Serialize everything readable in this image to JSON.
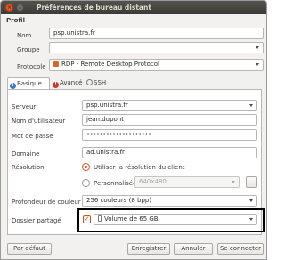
{
  "window": {
    "title": "Préférences de bureau distant"
  },
  "profile": {
    "section_label": "Profil",
    "name_label": "Nom",
    "name_value": "psp.unistra.fr",
    "group_label": "Groupe",
    "group_value": "",
    "protocol_label": "Protocole",
    "protocol_value": "RDP - Remote Desktop Protocol"
  },
  "tabs": [
    {
      "label": "Basique",
      "icon": "info-icon",
      "color": "#3b78c8"
    },
    {
      "label": "Avancé",
      "icon": "warning-icon",
      "color": "#d4362c"
    },
    {
      "label": "SSH",
      "icon": "ssh-icon",
      "color": "#7a7a7a"
    }
  ],
  "basic": {
    "server_label": "Serveur",
    "server_value": "psp.unistra.fr",
    "user_label": "Nom d'utilisateur",
    "user_value": "jean.dupont",
    "password_label": "Mot de passe",
    "password_value": "••••••••••••••••••••",
    "domain_label": "Domaine",
    "domain_value": "ad.unistra.fr",
    "resolution_label": "Résolution",
    "resolution_option_client": "Utiliser la résolution du client",
    "resolution_option_custom": "Personnalisée",
    "resolution_custom_value": "640x480",
    "resolution_more": "...",
    "color_depth_label": "Profondeur de couleur",
    "color_depth_value": "256 couleurs (8 bpp)",
    "shared_folder_label": "Dossier partagé",
    "shared_folder_value": "Volume de 65 GB"
  },
  "buttons": {
    "default": "Par défaut",
    "save": "Enregistrer",
    "cancel": "Annuler",
    "connect": "Se connecter"
  },
  "colors": {
    "accent": "#d9531e",
    "titlebar": "#3c3b37"
  }
}
